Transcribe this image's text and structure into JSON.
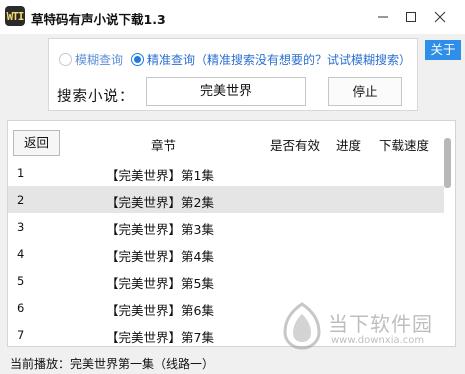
{
  "window": {
    "icon_text": "WTI",
    "title": "草特码有声小说下载1.3"
  },
  "search": {
    "mode_fuzzy_label": "模糊查询",
    "mode_exact_label": "精准查询（精准搜索没有想要的？试试模糊搜索）",
    "selected_mode": "exact",
    "label": "搜索小说：",
    "query_value": "完美世界",
    "stop_label": "停止"
  },
  "about_label": "关于",
  "list": {
    "back_label": "返回",
    "columns": {
      "chapter": "章节",
      "valid": "是否有效",
      "progress": "进度",
      "speed": "下载速度"
    },
    "rows": [
      {
        "num": "1",
        "name": "【完美世界】第1集"
      },
      {
        "num": "2",
        "name": "【完美世界】第2集"
      },
      {
        "num": "3",
        "name": "【完美世界】第3集"
      },
      {
        "num": "4",
        "name": "【完美世界】第4集"
      },
      {
        "num": "5",
        "name": "【完美世界】第5集"
      },
      {
        "num": "6",
        "name": "【完美世界】第6集"
      },
      {
        "num": "7",
        "name": "【完美世界】第7集"
      }
    ],
    "selected_row": 2
  },
  "status": {
    "now_playing": "当前播放：完美世界第一集（线路一）"
  },
  "watermark": {
    "name": "当下软件园",
    "url": "www.downxia.com"
  },
  "colors": {
    "accent": "#2e8ee8",
    "radio_blue": "#1f7ae0",
    "selected_row": "#e5e5e5"
  }
}
